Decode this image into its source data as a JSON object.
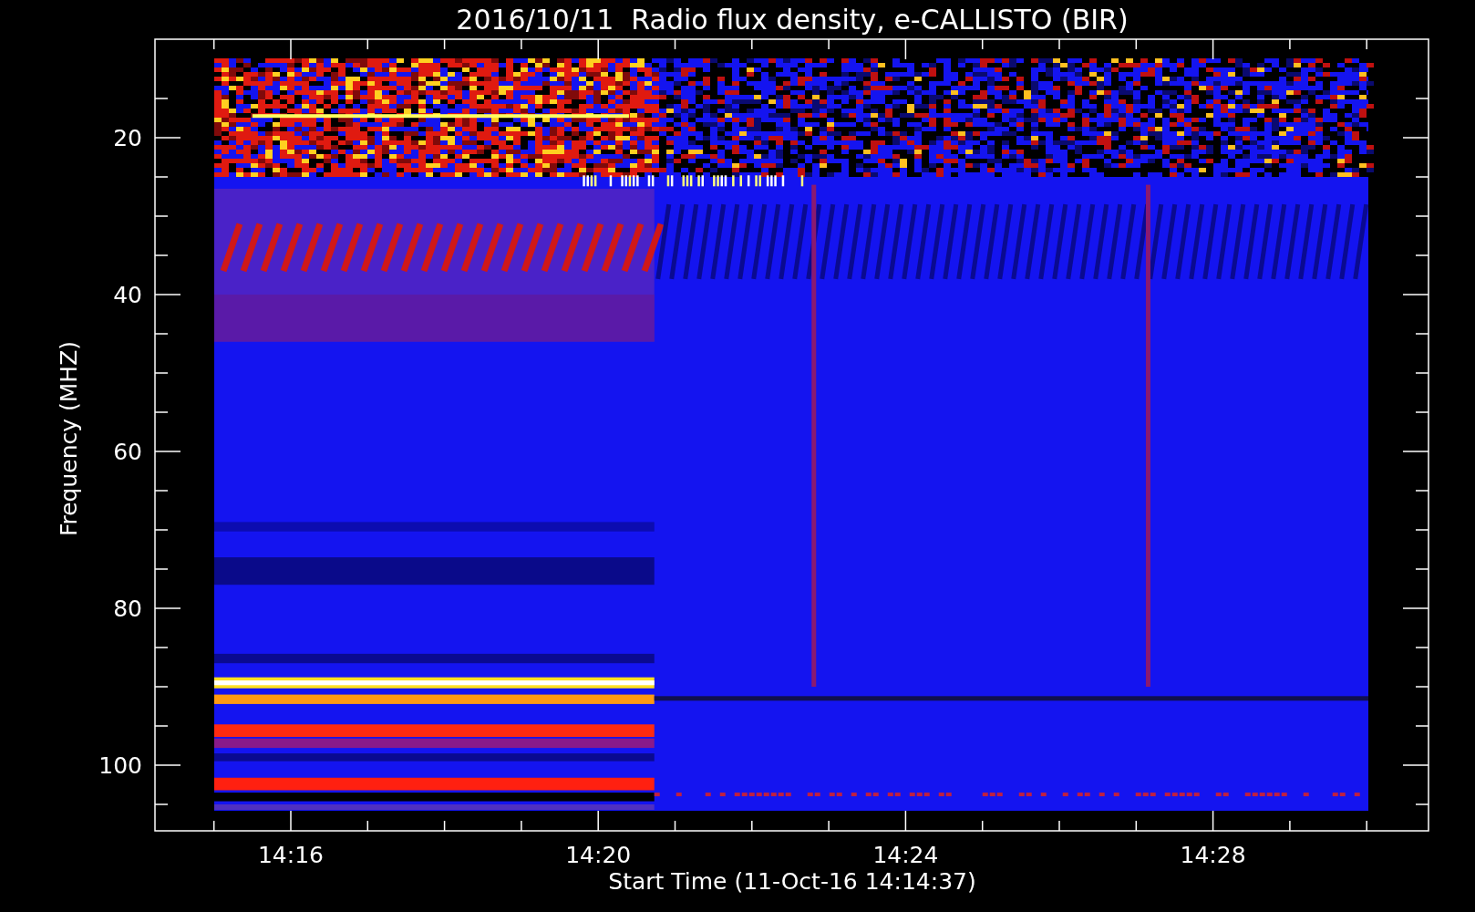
{
  "title": "2016/10/11  Radio flux density, e-CALLISTO (BIR)",
  "y_axis": {
    "label": "Frequency (MHZ)",
    "ticks": [
      "20",
      "40",
      "60",
      "80",
      "100"
    ]
  },
  "x_axis": {
    "label": "Start Time (11-Oct-16 14:14:37)",
    "ticks": [
      "14:16",
      "14:20",
      "14:24",
      "14:28"
    ]
  }
}
